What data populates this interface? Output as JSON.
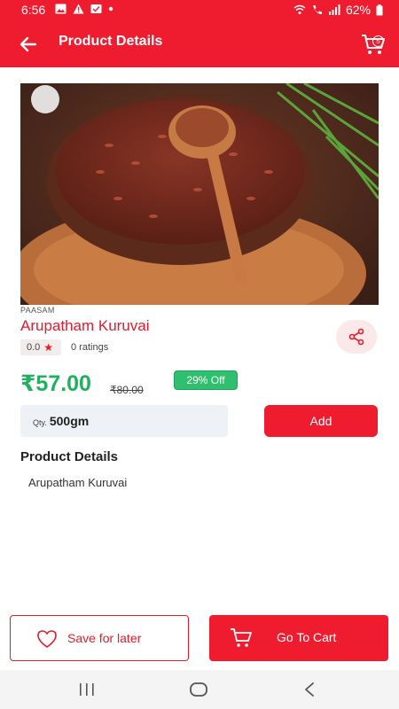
{
  "status_bar": {
    "time": "6:56",
    "battery": "62%"
  },
  "header": {
    "title": "Product Details",
    "cart_count": "5"
  },
  "product": {
    "brand": "PAASAM",
    "name": "Arupatham Kuruvai",
    "rating": "0.0",
    "ratings_count": "0 ratings",
    "price": "₹57.00",
    "mrp": "₹80.00",
    "discount": "29% Off",
    "qty_label": "Qty.",
    "qty_value": "500gm",
    "add_label": "Add"
  },
  "details": {
    "heading": "Product Details",
    "text": "Arupatham Kuruvai"
  },
  "footer": {
    "save_label": "Save for later",
    "cart_label": "Go To Cart"
  },
  "colors": {
    "brand": "#ee1c2e",
    "price": "#21b05f",
    "discount": "#2fbf6e"
  }
}
